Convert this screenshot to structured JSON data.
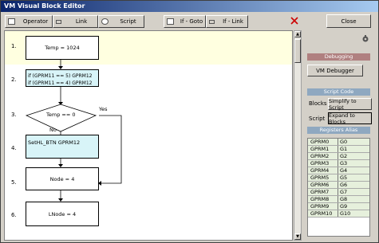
{
  "window": {
    "title": "VM Visual Block Editor"
  },
  "toolbar": {
    "operator": "Operator",
    "link": "Link",
    "script": "Script",
    "if_goto": "If - Goto",
    "if_link": "If - Link"
  },
  "flow": {
    "rows": [
      "1.",
      "2.",
      "3.",
      "4.",
      "5.",
      "6."
    ],
    "block1": "Temp = 1024",
    "block2_line1": "if (GPRM11 == 5) GPRM12",
    "block2_line2": "if (GPRM11 == 4) GPRM12",
    "cond": "Temp == 0",
    "yes": "Yes",
    "no": "No",
    "block4": "SetHL_BTN GPRM12",
    "block5": "Node = 4",
    "block6": "LNode = 4"
  },
  "right": {
    "close": "Close",
    "debugging": "Debugging",
    "vm_debugger": "VM Debugger",
    "script_code": "Script Code",
    "blocks_label": "Blocks",
    "simplify": "Simplify to Script",
    "script_label": "Script",
    "expand": "Expand to Blocks",
    "registers_alias": "Registers Alias"
  },
  "registers": [
    {
      "reg": "GPRM0",
      "alias": "G0"
    },
    {
      "reg": "GPRM1",
      "alias": "G1"
    },
    {
      "reg": "GPRM2",
      "alias": "G2"
    },
    {
      "reg": "GPRM3",
      "alias": "G3"
    },
    {
      "reg": "GPRM4",
      "alias": "G4"
    },
    {
      "reg": "GPRM5",
      "alias": "G5"
    },
    {
      "reg": "GPRM6",
      "alias": "G6"
    },
    {
      "reg": "GPRM7",
      "alias": "G7"
    },
    {
      "reg": "GPRM8",
      "alias": "G8"
    },
    {
      "reg": "GPRM9",
      "alias": "G9"
    },
    {
      "reg": "GPRM10",
      "alias": "G10"
    }
  ],
  "colors": {
    "block_fill": "#ffffff",
    "highlight_fill": "#d8f4f8",
    "top_band": "#ffffe0",
    "debug_header": "#b08080",
    "script_header": "#8fa8c0",
    "register_row": "#e6f0dc",
    "close_x": "#cc0000"
  },
  "icons": [
    "operator-icon",
    "link-icon",
    "script-icon",
    "if-goto-icon",
    "if-link-icon",
    "close-x-icon",
    "wrench-icon"
  ]
}
